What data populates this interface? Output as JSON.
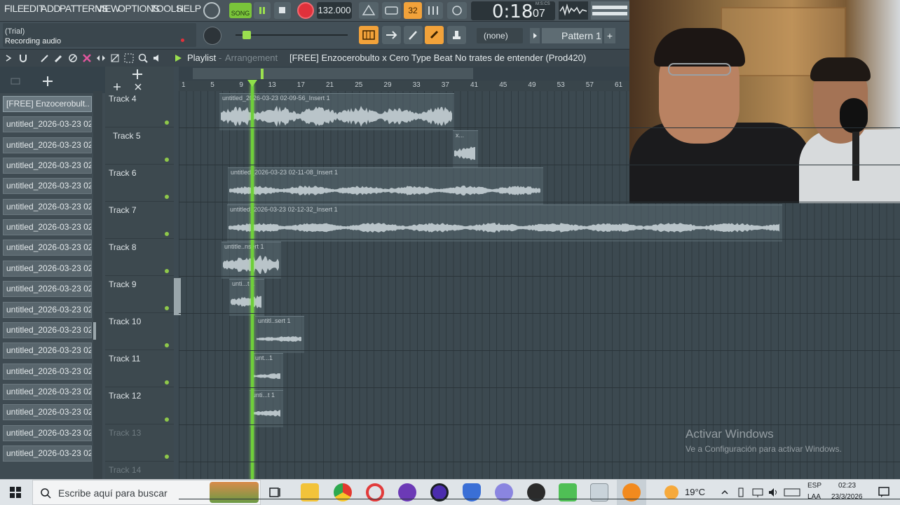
{
  "menu": [
    "FILE",
    "EDIT",
    "ADD",
    "PATTERNS",
    "VIEW",
    "OPTIONS",
    "TOOLS",
    "HELP"
  ],
  "transport": {
    "mode": "SONG",
    "tempo": "132.000",
    "time": "0:18",
    "time_small": "07",
    "time_unit": "M:S:CS",
    "pattern_counter": "32"
  },
  "hint": {
    "line1": "(Trial)",
    "line2": "Recording audio"
  },
  "pattern": {
    "none_label": "(none)",
    "pattern_label": "Pattern 1",
    "plus": "+"
  },
  "playlist": {
    "title": "Playlist",
    "subtitle": "Arrangement",
    "song_name": "[FREE] Enzocerobulto x Cero  Type Beat  No trates de entender  (Prod420)"
  },
  "ruler": [
    "1",
    "5",
    "9",
    "13",
    "17",
    "21",
    "25",
    "29",
    "33",
    "37",
    "41",
    "45",
    "49",
    "53",
    "57",
    "61"
  ],
  "clips_list": [
    "[FREE] Enzocerobult..",
    "untitled_2026-03-23 02-..",
    "untitled_2026-03-23 02-..",
    "untitled_2026-03-23 02-..",
    "untitled_2026-03-23 02-..",
    "untitled_2026-03-23 02-..",
    "untitled_2026-03-23 02-..",
    "untitled_2026-03-23 02-..",
    "untitled_2026-03-23 02-..",
    "untitled_2026-03-23 02-..",
    "untitled_2026-03-23 02-..",
    "untitled_2026-03-23 02-..",
    "untitled_2026-03-23 02-..",
    "untitled_2026-03-23 02-..",
    "untitled_2026-03-23 02-..",
    "untitled_2026-03-23 02-..",
    "untitled_2026-03-23 02-..",
    "untitled_2026-03-23 02-.."
  ],
  "tracks": [
    "Track 4",
    "Track 5",
    "Track 6",
    "Track 7",
    "Track 8",
    "Track 9",
    "Track 10",
    "Track 11",
    "Track 12",
    "Track 13",
    "Track 14"
  ],
  "audio_clips": [
    {
      "label": "untitled_2026-03-23 02-09-56_Insert 1"
    },
    {
      "label": "x..."
    },
    {
      "label": "untitled_2026-03-23 02-11-08_Insert 1"
    },
    {
      "label": "untitled_2026-03-23 02-12-32_Insert 1"
    },
    {
      "label": "untitle..nsert 1"
    },
    {
      "label": "unti...t 1"
    },
    {
      "label": "untitl..sert 1"
    },
    {
      "label": "unt...1"
    },
    {
      "label": "unti...t 1"
    }
  ],
  "watermark": {
    "title": "Activar Windows",
    "subtitle": "Ve a Configuración para activar Windows."
  },
  "taskbar": {
    "search_placeholder": "Escribe aquí para buscar",
    "weather": "19°C",
    "lang1": "ESP",
    "lang2": "LAA",
    "clock_time": "02:23",
    "clock_date": "23/3/2026"
  },
  "colors": {
    "playhead": "#6fcf3a",
    "record": "#e0313b",
    "accent_orange": "#f2a23a"
  }
}
